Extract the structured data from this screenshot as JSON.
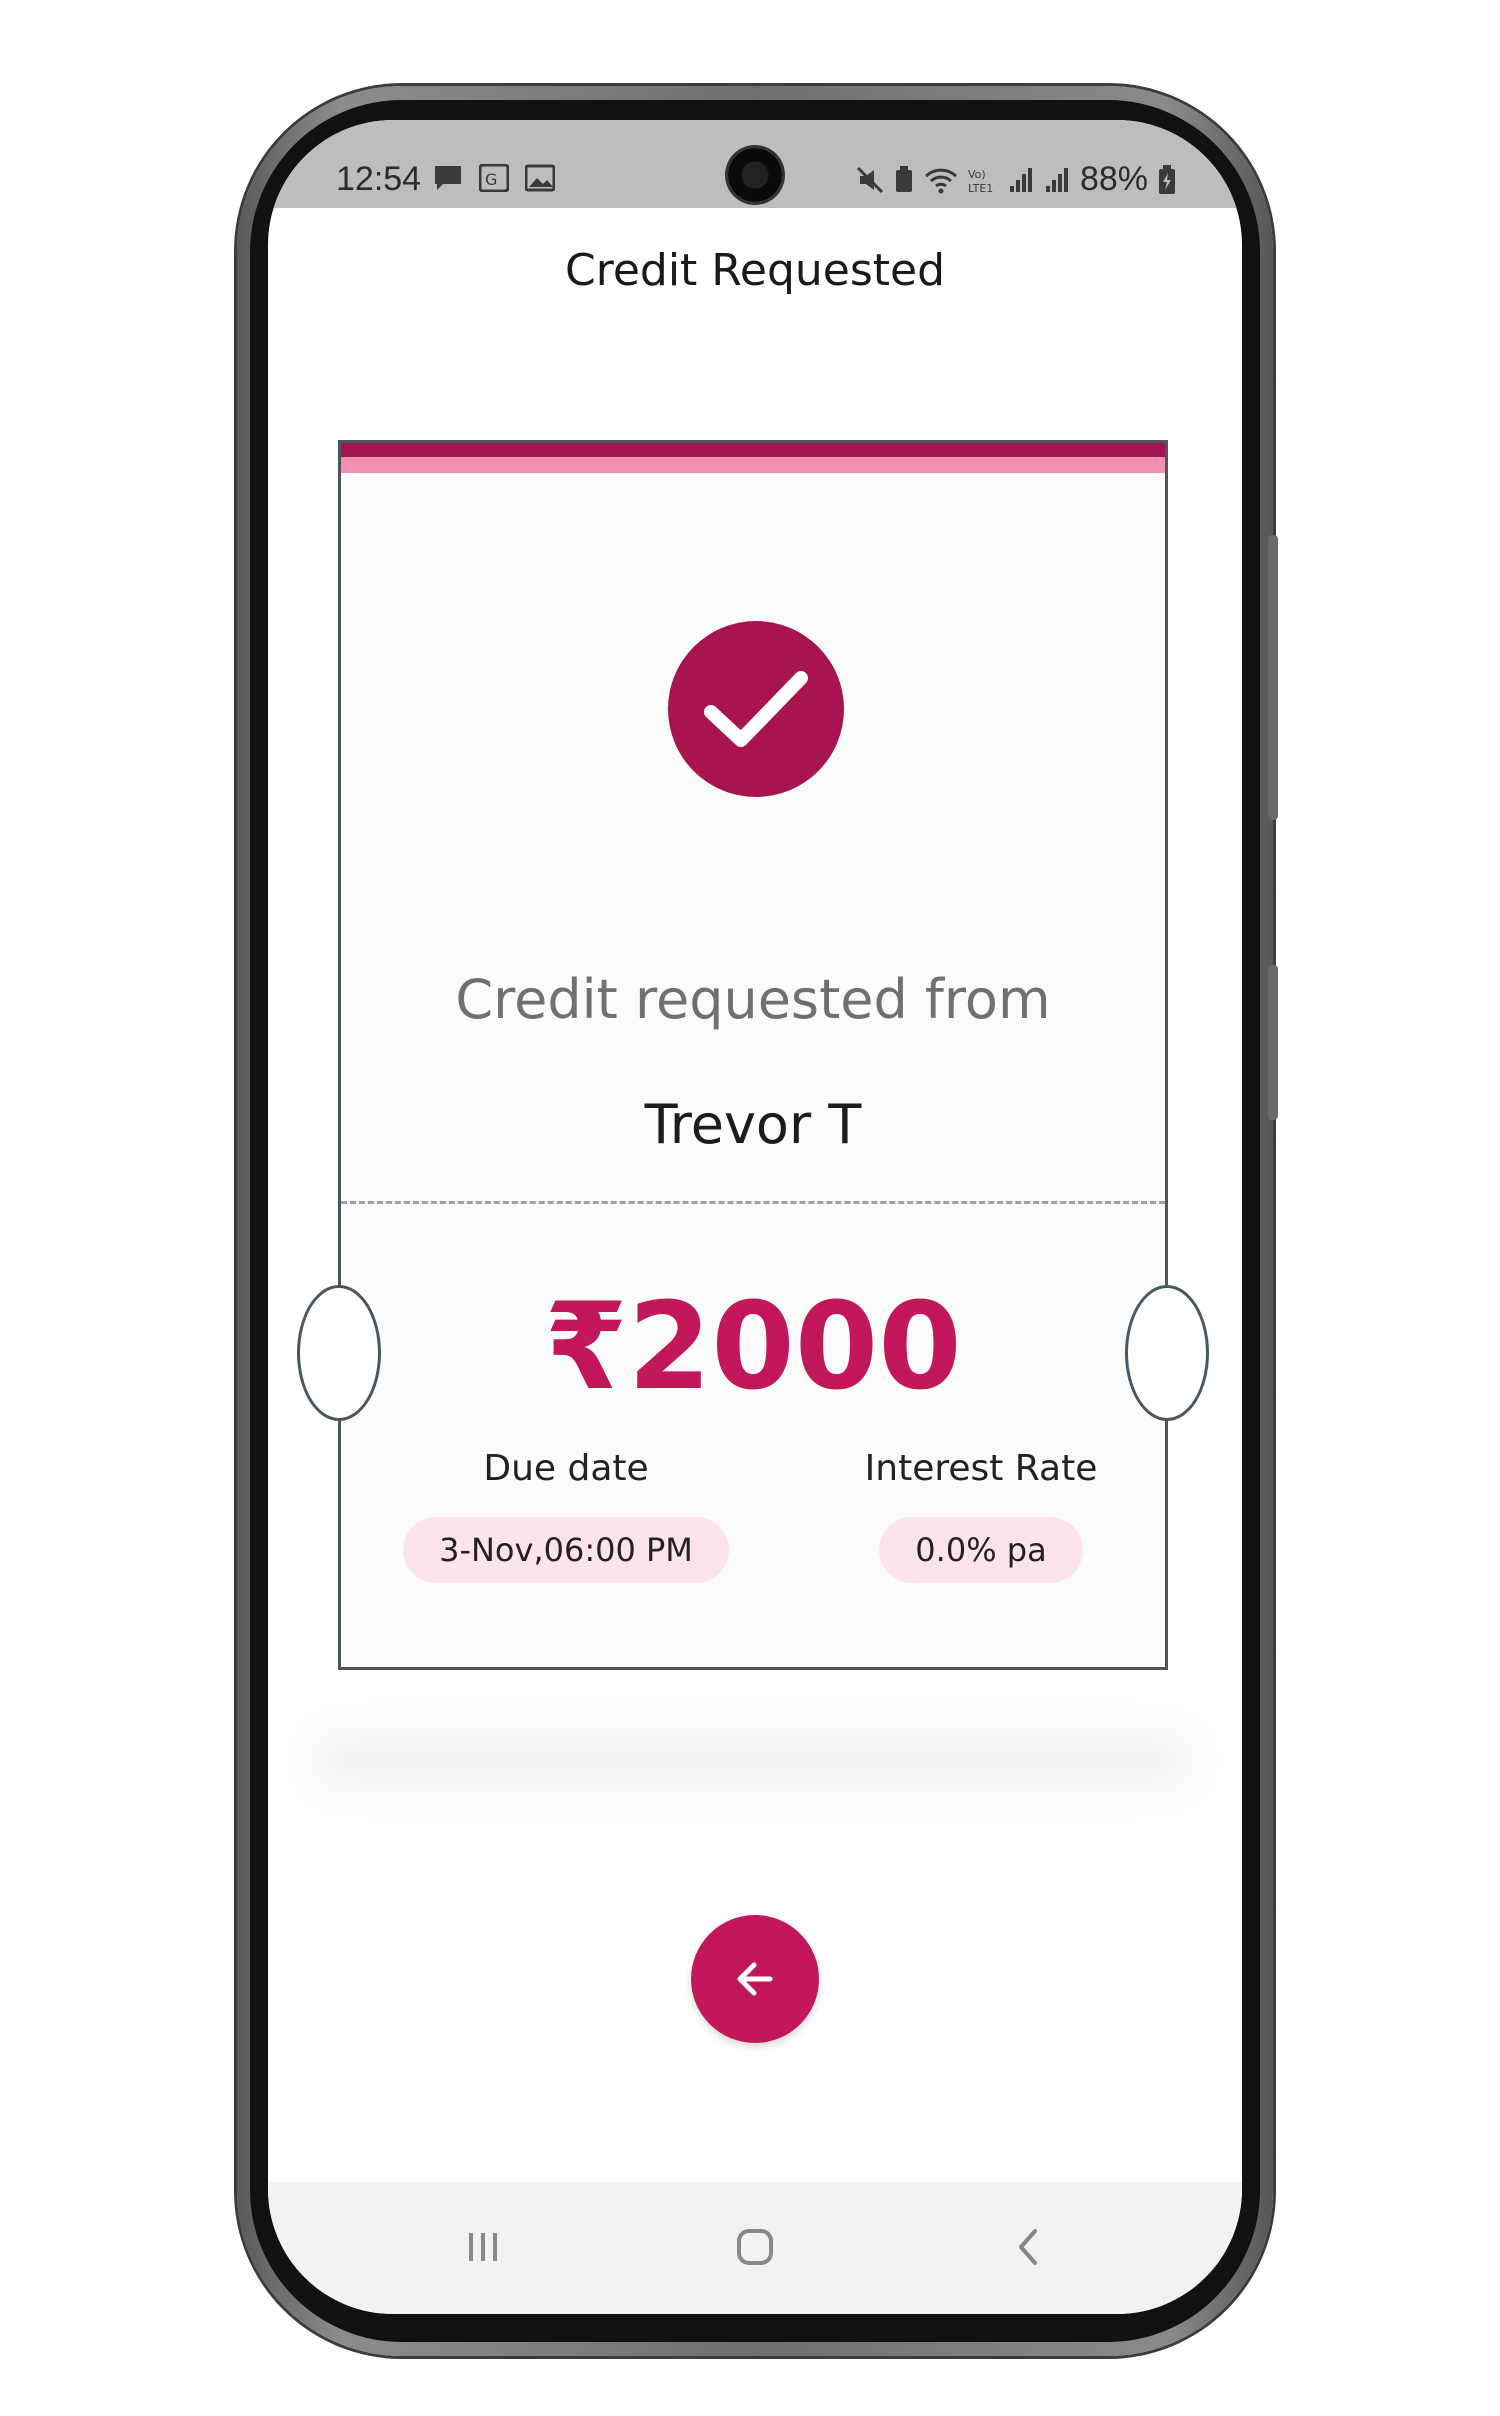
{
  "status_bar": {
    "time": "12:54",
    "battery": "88%",
    "left_icons": [
      "message-icon",
      "translate-icon",
      "image-icon"
    ],
    "right_icons": [
      "mute-icon",
      "battery-saver-icon",
      "wifi-icon",
      "volte-icon",
      "signal-icon",
      "signal-icon-2",
      "battery-icon"
    ]
  },
  "header": {
    "title": "Credit Requested"
  },
  "ticket": {
    "subtitle": "Credit requested from",
    "name": "Trevor T",
    "amount": "₹2000",
    "due_label": "Due date",
    "due_value": "3-Nov,06:00 PM",
    "rate_label": "Interest Rate",
    "rate_value": "0.0% pa"
  },
  "colors": {
    "accent": "#c2185b",
    "accent_dark": "#a8144f",
    "pill_bg": "#fde4ec",
    "stripe_light": "#f48fb1"
  },
  "icons": {
    "check": "check-icon",
    "back": "arrow-left-icon",
    "nav_recents": "recents-icon",
    "nav_home": "home-icon",
    "nav_back": "chevron-left-icon"
  }
}
